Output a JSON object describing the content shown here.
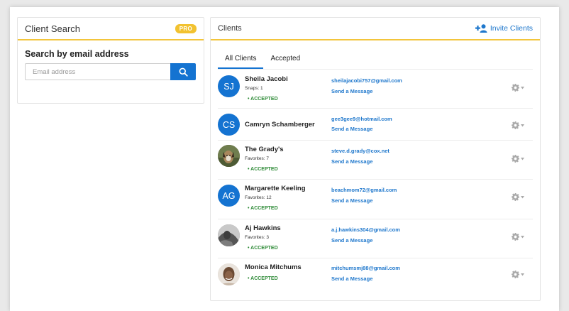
{
  "client_search": {
    "title": "Client Search",
    "badge": "PRO",
    "search_label": "Search by email address",
    "email_placeholder": "Email address",
    "search_icon": "search-icon"
  },
  "clients_panel": {
    "title": "Clients",
    "invite_label": "Invite Clients",
    "invite_icon": "add-user-icon",
    "tabs": [
      {
        "label": "All Clients",
        "active": true
      },
      {
        "label": "Accepted",
        "active": false
      }
    ]
  },
  "colors": {
    "primary": "#1473d1",
    "link": "#1e77cc",
    "accent": "#f3c53b",
    "accepted": "#2e8b37"
  },
  "clients": [
    {
      "name": "Sheila Jacobi",
      "initials": "SJ",
      "sub": "Snaps: 1",
      "status": "• ACCEPTED",
      "email": "sheilajacobi757@gmail.com",
      "message": "Send a Message"
    },
    {
      "name": "Camryn Schamberger",
      "initials": "CS",
      "sub": "",
      "status": "",
      "email": "gee3gee9@hotmail.com",
      "message": "Send a Message"
    },
    {
      "name": "The Grady's",
      "initials": "",
      "sub": "Favorites: 7",
      "status": "• ACCEPTED",
      "email": "steve.d.grady@cox.net",
      "message": "Send a Message"
    },
    {
      "name": "Margarette Keeling",
      "initials": "AG",
      "sub": "Favorites: 12",
      "status": "• ACCEPTED",
      "email": "beachmom72@gmail.com",
      "message": "Send a Message"
    },
    {
      "name": "Aj Hawkins",
      "initials": "",
      "sub": "Favorites: 3",
      "status": "• ACCEPTED",
      "email": "a.j.hawkins304@gmail.com",
      "message": "Send a Message"
    },
    {
      "name": "Monica Mitchums",
      "initials": "",
      "sub": "",
      "status": "• ACCEPTED",
      "email": "mitchumsmj88@gmail.com",
      "message": "Send a Message"
    }
  ]
}
